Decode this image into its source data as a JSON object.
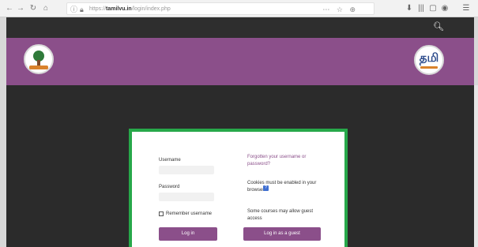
{
  "browser": {
    "nav_icons": {
      "back": "←",
      "forward": "→",
      "reload": "↻",
      "home": "⌂"
    },
    "url_prefix": "https://",
    "url_domain": "tamilvu.in",
    "url_path": "/login/index.php",
    "url_icons": "⋯ ☆ ⊕",
    "toolbar_icons": [
      "⬇",
      "|||",
      "▢",
      "◉",
      "☰"
    ]
  },
  "site": {
    "search_icon": "search-icon",
    "logo_right_text": "தமி"
  },
  "login": {
    "username_label": "Username",
    "password_label": "Password",
    "remember_label": "Remember username",
    "login_button": "Log in",
    "forgot_line1": "Forgotten your username or",
    "forgot_line2": "password?",
    "cookies_line1": "Cookies must be enabled in your",
    "cookies_line2": "browser",
    "help_icon": "?",
    "guest_line1": "Some courses may allow guest",
    "guest_line2": "access",
    "guest_button": "Log in as a guest"
  },
  "colors": {
    "brand_purple": "#8b4f8a",
    "card_border_green": "#27a84a",
    "nav_dark": "#2e2e2e",
    "body_dark": "#2b2b2b"
  }
}
